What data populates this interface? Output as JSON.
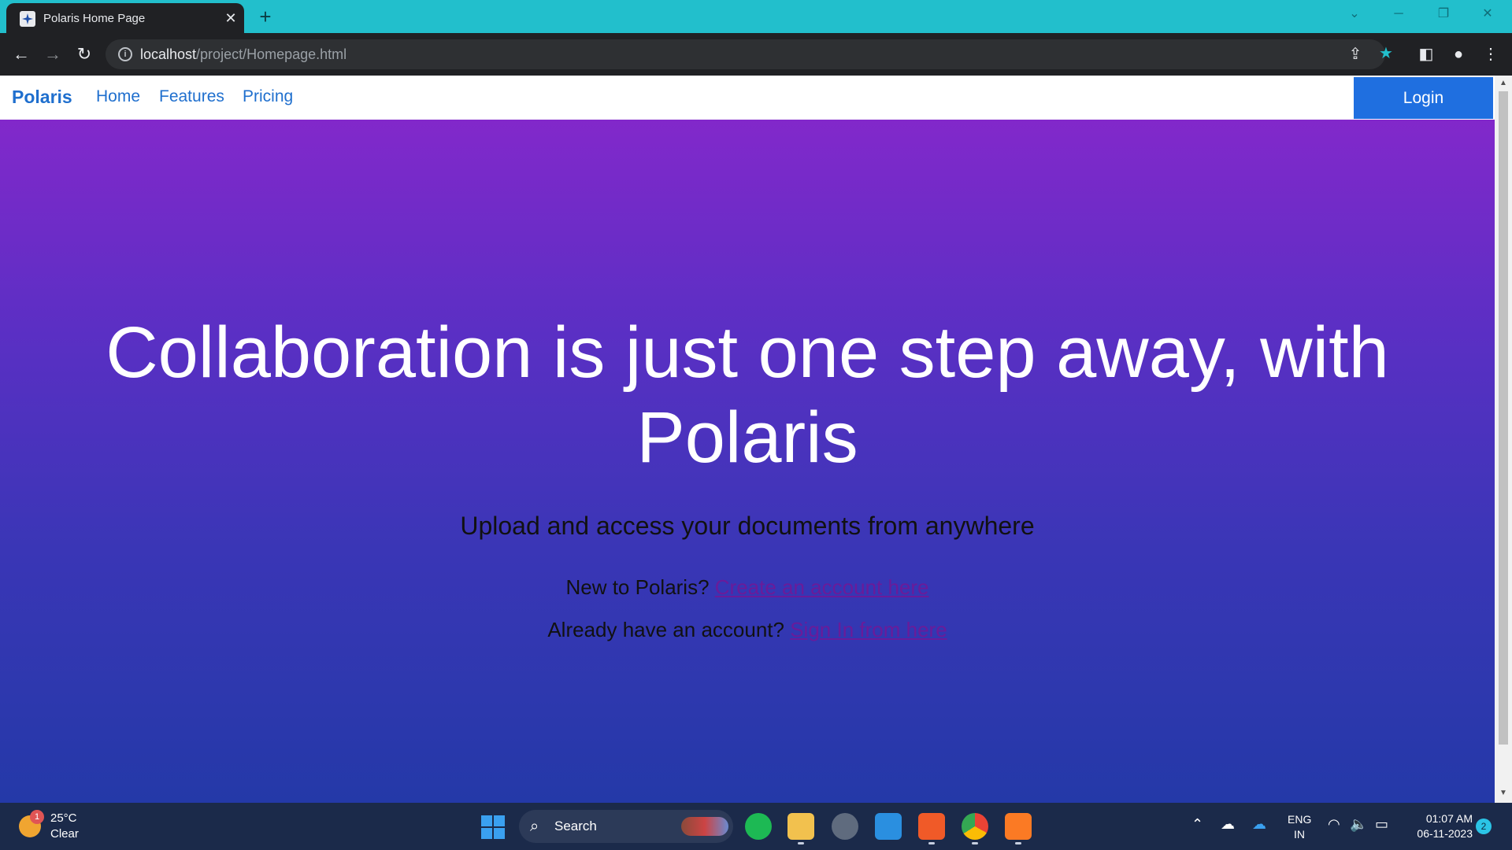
{
  "browser": {
    "tab_title": "Polaris Home Page",
    "tab_close": "✕",
    "new_tab": "+",
    "url_host": "localhost",
    "url_path": "/project/Homepage.html"
  },
  "page": {
    "brand": "Polaris",
    "nav_links": [
      "Home",
      "Features",
      "Pricing"
    ],
    "login_label": "Login",
    "hero_title": "Collaboration is just one step away, with Polaris",
    "hero_subtitle": "Upload and access your documents from anywhere",
    "new_user_prompt": "New to Polaris?",
    "new_user_link": "Create an account here",
    "existing_user_prompt": "Already have an account?",
    "existing_user_link": "Sign In from here"
  },
  "taskbar": {
    "weather_temp": "25°C",
    "weather_desc": "Clear",
    "weather_badge": "1",
    "search_label": "Search",
    "lang_line1": "ENG",
    "lang_line2": "IN",
    "time": "01:07 AM",
    "date": "06-11-2023",
    "notifications": "2"
  },
  "colors": {
    "accent": "#1f6fce",
    "titlebar": "#22bfcc",
    "gradient_top": "#8a27cc",
    "gradient_bottom": "#2439a8"
  }
}
